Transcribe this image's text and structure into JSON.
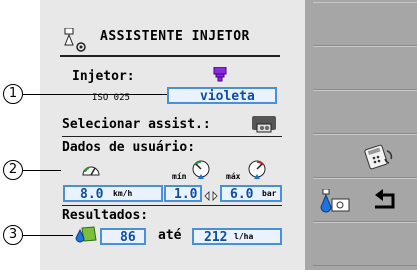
{
  "title": "ASSISTENTE INJETOR",
  "injector": {
    "label": "Injetor:",
    "iso": "ISO 025",
    "value": "violeta",
    "color": "#8a2be2"
  },
  "select_assist": {
    "label": "Selecionar assist.:"
  },
  "user_data": {
    "label": "Dados de usuário:",
    "speed": {
      "value": "8.0",
      "unit": "km/h"
    },
    "pressure_min": {
      "label": "mín",
      "value": "1.0"
    },
    "pressure_max": {
      "label": "máx",
      "value": "6.0",
      "unit": "bar"
    }
  },
  "results": {
    "label": "Resultados:",
    "from": "86",
    "to_word": "até",
    "to": "212",
    "unit": "l/ha"
  },
  "callouts": [
    "1",
    "2",
    "3"
  ],
  "colors": {
    "accent": "#4a90d9",
    "sidebar": "#a6a6a6",
    "panel": "#e8e8e8"
  }
}
